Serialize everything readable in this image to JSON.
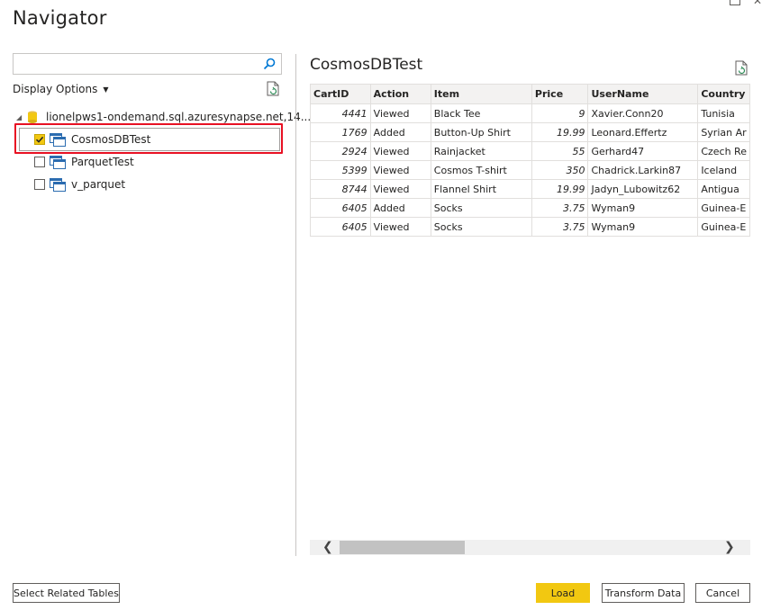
{
  "window": {
    "title": "Navigator",
    "close_glyph": "✕"
  },
  "left_pane": {
    "search": {
      "value": "",
      "placeholder": ""
    },
    "display_options_label": "Display Options",
    "tree": {
      "root_label": "lionelpws1-ondemand.sql.azuresynapse.net,14...",
      "items": [
        {
          "label": "CosmosDBTest",
          "checked": true
        },
        {
          "label": "ParquetTest",
          "checked": false
        },
        {
          "label": "v_parquet",
          "checked": false
        }
      ]
    }
  },
  "preview": {
    "title": "CosmosDBTest",
    "columns": [
      "CartID",
      "Action",
      "Item",
      "Price",
      "UserName",
      "Country"
    ],
    "rows": [
      [
        "4441",
        "Viewed",
        "Black Tee",
        "9",
        "Xavier.Conn20",
        "Tunisia"
      ],
      [
        "1769",
        "Added",
        "Button-Up Shirt",
        "19.99",
        "Leonard.Effertz",
        "Syrian Ar"
      ],
      [
        "2924",
        "Viewed",
        "Rainjacket",
        "55",
        "Gerhard47",
        "Czech Re"
      ],
      [
        "5399",
        "Viewed",
        "Cosmos T-shirt",
        "350",
        "Chadrick.Larkin87",
        "Iceland"
      ],
      [
        "8744",
        "Viewed",
        "Flannel Shirt",
        "19.99",
        "Jadyn_Lubowitz62",
        "Antigua"
      ],
      [
        "6405",
        "Added",
        "Socks",
        "3.75",
        "Wyman9",
        "Guinea-E"
      ],
      [
        "6405",
        "Viewed",
        "Socks",
        "3.75",
        "Wyman9",
        "Guinea-E"
      ]
    ],
    "scroll_left": "❮",
    "scroll_right": "❯"
  },
  "footer": {
    "select_related_label": "Select Related Tables",
    "load_label": "Load",
    "transform_label": "Transform Data",
    "cancel_label": "Cancel"
  },
  "colors": {
    "accent": "#f2c811",
    "highlight_border": "#e81123",
    "header_bg": "#f3f2f1"
  },
  "icons": [
    "search-icon",
    "document-refresh-icon",
    "database-icon",
    "table-icon",
    "checkbox-check-icon"
  ]
}
